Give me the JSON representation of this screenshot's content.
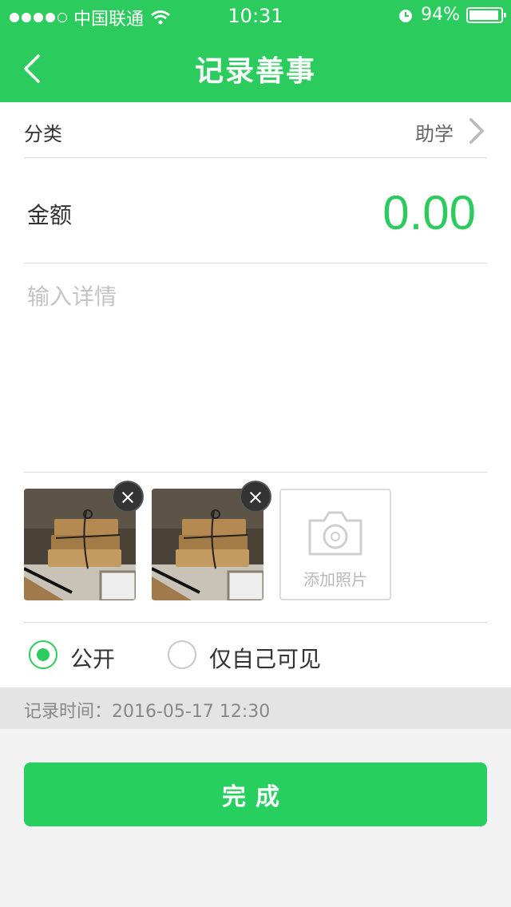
{
  "status_bar": {
    "carrier": "中国联通",
    "time": "10:31",
    "battery_percent": "94%",
    "battery_level": 0.94
  },
  "nav": {
    "title": "记录善事",
    "back_icon": "chevron-left-icon"
  },
  "form": {
    "category_label": "分类",
    "category_value": "助学",
    "amount_label": "金额",
    "amount_value": "0.00",
    "details_placeholder": "输入详情",
    "add_photo_label": "添加照片",
    "visibility": [
      {
        "label": "公开",
        "selected": true
      },
      {
        "label": "仅自己可见",
        "selected": false
      }
    ],
    "record_time": "记录时间：2016-05-17  12:30"
  },
  "done_button": "完成",
  "colors": {
    "accent": "#2ccb5e",
    "divider": "#dcdcdc",
    "time_bar": "#e4e4e4"
  }
}
